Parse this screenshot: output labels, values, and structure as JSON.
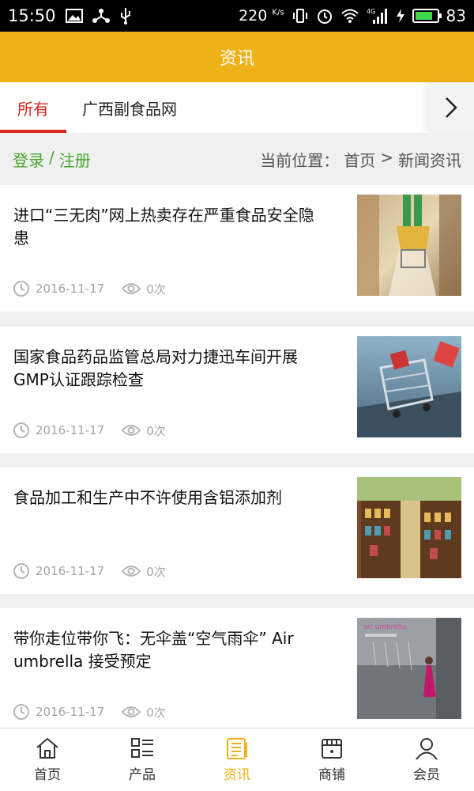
{
  "status_bar": {
    "time": "15:50",
    "network_speed": "220",
    "network_speed_unit": "K/s",
    "signal_label": "4G",
    "battery": "83",
    "battery_level_percent": 83,
    "battery_color": "#3fd84a"
  },
  "header": {
    "title": "资讯",
    "color": "#eeb219"
  },
  "tabs": {
    "items": [
      {
        "label": "所有",
        "active": true
      },
      {
        "label": "广西副食品网",
        "active": false
      }
    ],
    "active_color": "#d9261c"
  },
  "user": {
    "login": "登录",
    "separator": "/",
    "register": "注册",
    "color": "#4aa62e"
  },
  "breadcrumb": {
    "prefix": "当前位置：",
    "home": "首页",
    "separator": ">",
    "current": "新闻资讯"
  },
  "news": [
    {
      "title": "进口“三无肉”网上热卖存在严重食品安全隐患",
      "date": "2016-11-17",
      "views": "0次",
      "thumb_icon": "supermarket-photo"
    },
    {
      "title": "国家食品药品监管总局对力捷迅车间开展GMP认证跟踪检查",
      "date": "2016-11-17",
      "views": "0次",
      "thumb_icon": "shopping-cart-photo"
    },
    {
      "title": "食品加工和生产中不许使用含铝添加剂",
      "date": "2016-11-17",
      "views": "0次",
      "thumb_icon": "shop-shelves-photo"
    },
    {
      "title": "带你走位带你飞：无伞盖“空气雨伞” Air umbrella 接受预定",
      "date": "2016-11-17",
      "views": "0次",
      "thumb_icon": "air-umbrella-photo",
      "thumb_caption": "air umbrella"
    }
  ],
  "bottom_nav": [
    {
      "label": "首页",
      "icon": "home-icon",
      "active": false
    },
    {
      "label": "产品",
      "icon": "list-icon",
      "active": false
    },
    {
      "label": "资讯",
      "icon": "news-icon",
      "active": true
    },
    {
      "label": "商铺",
      "icon": "shop-icon",
      "active": false
    },
    {
      "label": "会员",
      "icon": "user-icon",
      "active": false
    }
  ]
}
